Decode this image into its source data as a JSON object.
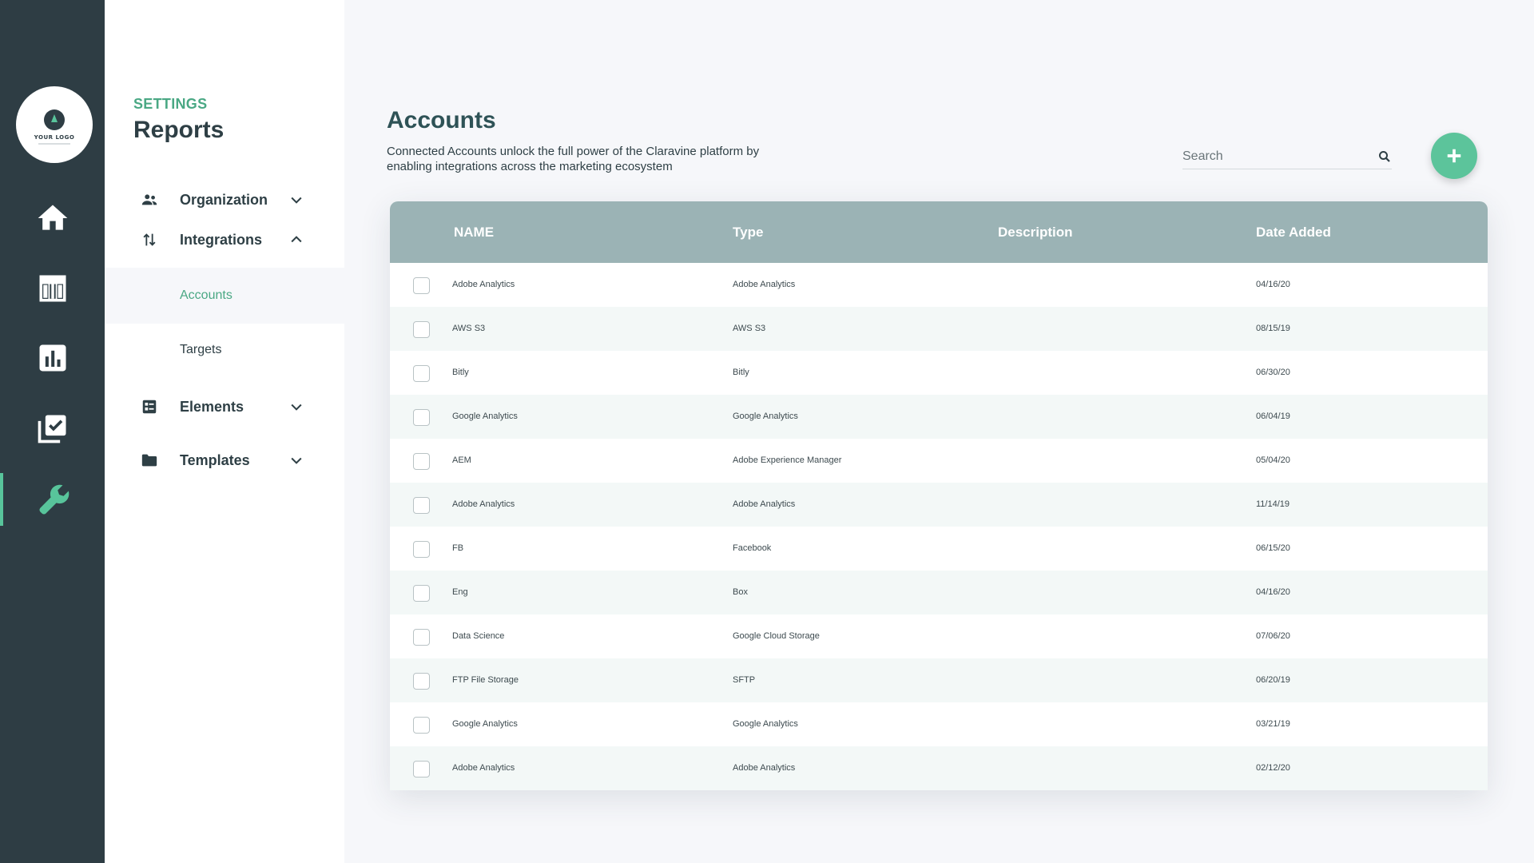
{
  "logo": {
    "text": "YOUR LOGO"
  },
  "rail": [
    {
      "name": "home-icon",
      "active": false
    },
    {
      "name": "table-icon",
      "active": false
    },
    {
      "name": "bar-chart-icon",
      "active": false
    },
    {
      "name": "checklist-icon",
      "active": false
    },
    {
      "name": "wrench-icon",
      "active": true
    }
  ],
  "settings": {
    "label": "SETTINGS",
    "title": "Reports",
    "nav": {
      "organization": "Organization",
      "integrations": "Integrations",
      "accounts": "Accounts",
      "targets": "Targets",
      "elements": "Elements",
      "templates": "Templates"
    }
  },
  "main": {
    "title": "Accounts",
    "description": "Connected Accounts unlock the full power of the Claravine platform by enabling integrations across the marketing ecosystem",
    "search_placeholder": "Search"
  },
  "table": {
    "columns": [
      "NAME",
      "Type",
      "Description",
      "Date Added"
    ],
    "rows": [
      {
        "name": "Adobe Analytics",
        "type": "Adobe Analytics",
        "description": "",
        "date": "04/16/20"
      },
      {
        "name": "AWS S3",
        "type": "AWS S3",
        "description": "",
        "date": "08/15/19"
      },
      {
        "name": "Bitly",
        "type": "Bitly",
        "description": "",
        "date": "06/30/20"
      },
      {
        "name": "Google Analytics",
        "type": "Google Analytics",
        "description": "",
        "date": "06/04/19"
      },
      {
        "name": "AEM",
        "type": "Adobe Experience Manager",
        "description": "",
        "date": "05/04/20"
      },
      {
        "name": "Adobe Analytics",
        "type": "Adobe Analytics",
        "description": "",
        "date": "11/14/19"
      },
      {
        "name": "FB",
        "type": "Facebook",
        "description": "",
        "date": "06/15/20"
      },
      {
        "name": "Eng",
        "type": "Box",
        "description": "",
        "date": "04/16/20"
      },
      {
        "name": "Data Science",
        "type": "Google Cloud Storage",
        "description": "",
        "date": "07/06/20"
      },
      {
        "name": "FTP File Storage",
        "type": "SFTP",
        "description": "",
        "date": "06/20/19"
      },
      {
        "name": "Google Analytics",
        "type": "Google Analytics",
        "description": "",
        "date": "03/21/19"
      },
      {
        "name": "Adobe Analytics",
        "type": "Adobe Analytics",
        "description": "",
        "date": "02/12/20"
      }
    ]
  },
  "colors": {
    "rail": "#2e3d44",
    "accent": "#58c49b",
    "header": "#9bb3b5"
  }
}
